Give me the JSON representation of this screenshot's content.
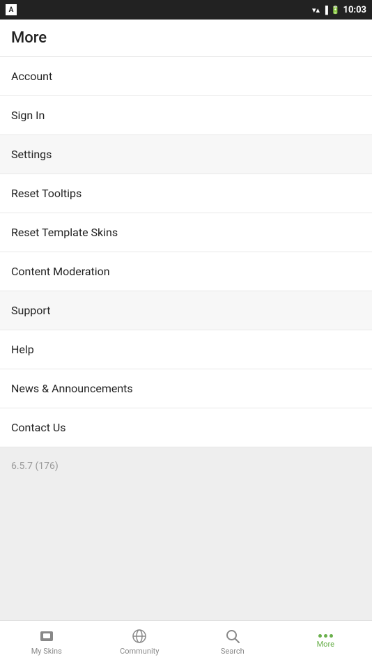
{
  "statusBar": {
    "time": "10:03",
    "appIcon": "A"
  },
  "header": {
    "title": "More"
  },
  "menuItems": [
    {
      "id": "account",
      "label": "Account"
    },
    {
      "id": "sign-in",
      "label": "Sign In"
    },
    {
      "id": "settings",
      "label": "Settings"
    },
    {
      "id": "reset-tooltips",
      "label": "Reset Tooltips"
    },
    {
      "id": "reset-template-skins",
      "label": "Reset Template Skins"
    },
    {
      "id": "content-moderation",
      "label": "Content Moderation"
    },
    {
      "id": "support",
      "label": "Support"
    },
    {
      "id": "help",
      "label": "Help"
    },
    {
      "id": "news-announcements",
      "label": "News & Announcements"
    },
    {
      "id": "contact-us",
      "label": "Contact Us"
    }
  ],
  "version": {
    "text": "6.5.7 (176)"
  },
  "bottomNav": {
    "items": [
      {
        "id": "my-skins",
        "label": "My Skins",
        "icon": "skins",
        "active": false
      },
      {
        "id": "community",
        "label": "Community",
        "icon": "community",
        "active": false
      },
      {
        "id": "search",
        "label": "Search",
        "icon": "search",
        "active": false
      },
      {
        "id": "more",
        "label": "More",
        "icon": "more",
        "active": true
      }
    ]
  }
}
